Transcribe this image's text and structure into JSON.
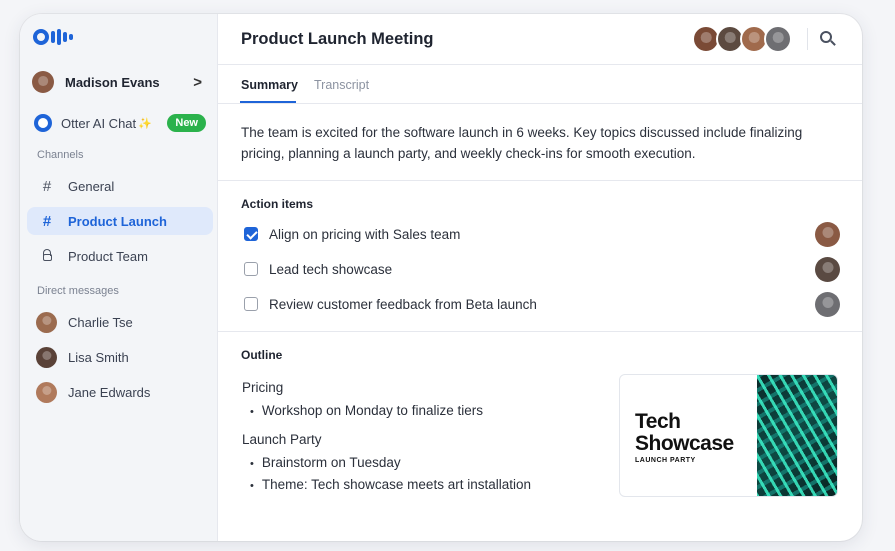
{
  "app": {
    "logo": "Otter",
    "accent": "#1e64d8"
  },
  "sidebar": {
    "user": {
      "name": "Madison Evans",
      "avatar_color": "#8a5a44",
      "chevron": ">"
    },
    "otter_chat": {
      "label": "Otter AI Chat",
      "sparkle": "✨",
      "badge": "New",
      "badge_color": "#2bb24c"
    },
    "channels_label": "Channels",
    "channels": [
      {
        "icon": "#",
        "label": "General",
        "active": false
      },
      {
        "icon": "#",
        "label": "Product Launch",
        "active": true
      },
      {
        "icon": "lock",
        "label": "Product Team",
        "active": false
      }
    ],
    "dm_label": "Direct messages",
    "dms": [
      {
        "name": "Charlie Tse",
        "avatar_color": "#9b6b4f"
      },
      {
        "name": "Lisa Smith",
        "avatar_color": "#5a4238"
      },
      {
        "name": "Jane Edwards",
        "avatar_color": "#b07a5c"
      }
    ]
  },
  "header": {
    "title": "Product Launch Meeting",
    "participants": [
      "#7a4a36",
      "#5c4a40",
      "#a06a4c",
      "#6e6e72"
    ]
  },
  "tabs": [
    {
      "label": "Summary",
      "active": true
    },
    {
      "label": "Transcript",
      "active": false
    }
  ],
  "summary": "The team is excited for the software launch in 6 weeks. Key topics discussed include finalizing pricing, planning a launch party, and weekly check-ins for smooth execution.",
  "action_items": {
    "heading": "Action items",
    "items": [
      {
        "label": "Align on pricing with Sales team",
        "checked": true,
        "avatar_color": "#8a5a44"
      },
      {
        "label": "Lead tech showcase",
        "checked": false,
        "avatar_color": "#5a4a42"
      },
      {
        "label": "Review customer feedback from Beta launch",
        "checked": false,
        "avatar_color": "#6e6e72"
      }
    ]
  },
  "outline": {
    "heading": "Outline",
    "sections": [
      {
        "title": "Pricing",
        "bullets": [
          "Workshop on Monday to finalize tiers"
        ]
      },
      {
        "title": "Launch Party",
        "bullets": [
          "Brainstorm on Tuesday",
          "Theme: Tech showcase meets art installation"
        ]
      }
    ]
  },
  "card": {
    "title_line1": "Tech",
    "title_line2": "Showcase",
    "subtitle": "LAUNCH PARTY"
  }
}
